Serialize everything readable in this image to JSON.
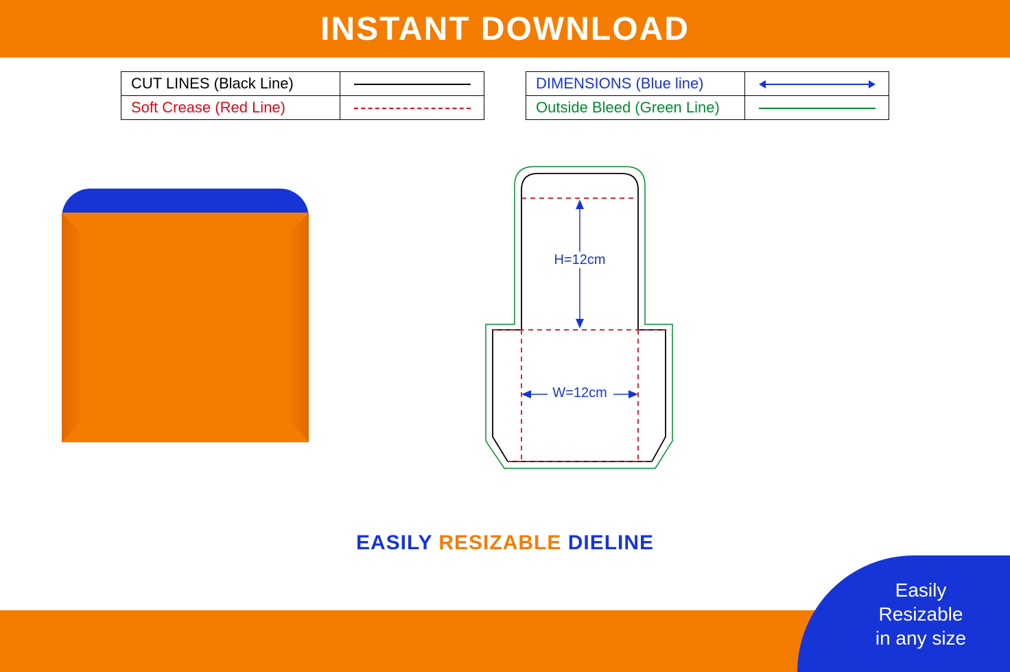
{
  "header": {
    "title": "INSTANT DOWNLOAD"
  },
  "legend": {
    "left": {
      "row1_label": "CUT LINES (Black Line)",
      "row2_label": "Soft Crease (Red Line)"
    },
    "right": {
      "row1_label": "DIMENSIONS (Blue line)",
      "row2_label": "Outside Bleed (Green Line)"
    }
  },
  "dieline": {
    "height_label": "H=12cm",
    "width_label": "W=12cm"
  },
  "tagline": {
    "w1": "EASILY",
    "w2": "RESIZABLE",
    "w3": "DIELINE"
  },
  "badge": {
    "line1": "Easily",
    "line2": "Resizable",
    "line3": "in any size"
  },
  "colors": {
    "orange": "#f47c00",
    "blue": "#1735d6",
    "red": "#e30613",
    "green": "#008c2e",
    "black": "#000000"
  },
  "chart_data": {
    "type": "dieline-template",
    "dimensions": {
      "width_cm": 12,
      "height_cm": 12,
      "width_label": "W=12cm",
      "height_label": "H=12cm"
    },
    "line_types": [
      {
        "name": "CUT LINES",
        "color": "Black",
        "style": "solid"
      },
      {
        "name": "Soft Crease",
        "color": "Red",
        "style": "dashed"
      },
      {
        "name": "DIMENSIONS",
        "color": "Blue",
        "style": "solid-double-arrow"
      },
      {
        "name": "Outside Bleed",
        "color": "Green",
        "style": "solid"
      }
    ]
  }
}
